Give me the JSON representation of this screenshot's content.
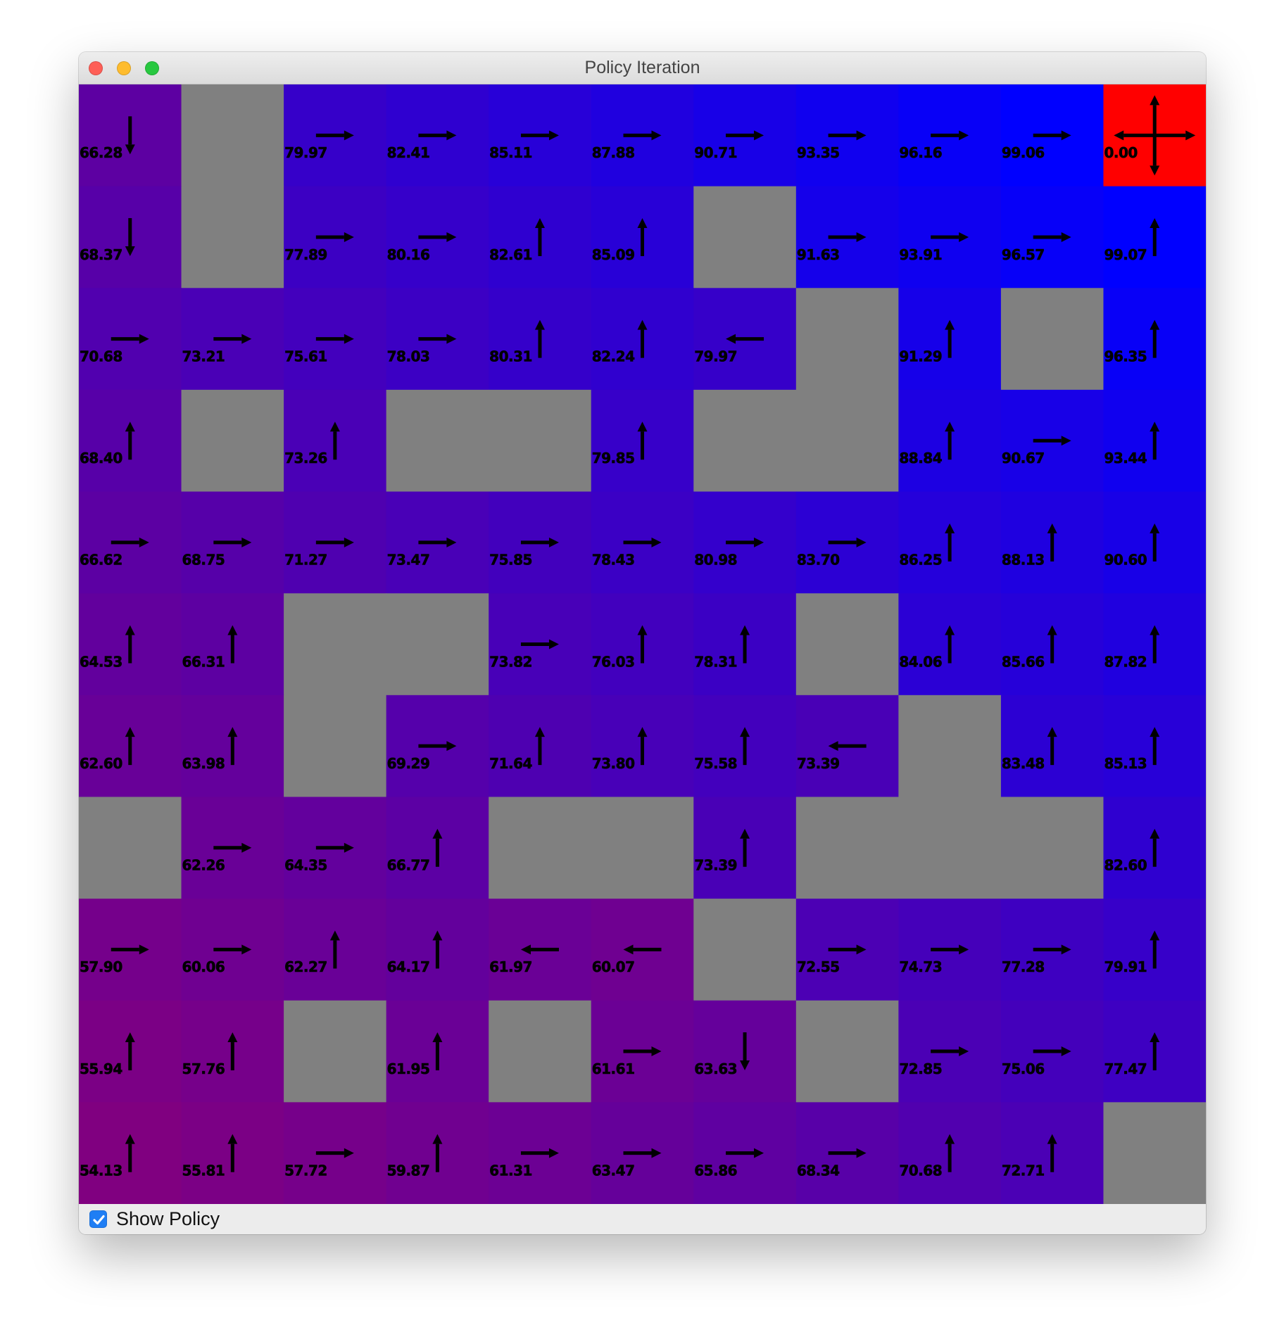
{
  "window": {
    "title": "Policy Iteration",
    "traffic_lights": [
      {
        "name": "close",
        "color": "#fe5f57"
      },
      {
        "name": "minimize",
        "color": "#febc2e"
      },
      {
        "name": "zoom",
        "color": "#28c840"
      }
    ]
  },
  "controls": {
    "show_policy_label": "Show Policy",
    "show_policy_checked": true
  },
  "colors": {
    "wall": "#808080",
    "goal": "#ff0000",
    "arrow": "#000000",
    "high_value": "#0000ff",
    "low_value": "#800080"
  },
  "grid": {
    "rows": 11,
    "cols": 11,
    "cells": [
      [
        {
          "v": "66.28",
          "a": "down"
        },
        {
          "wall": true
        },
        {
          "v": "79.97",
          "a": "right"
        },
        {
          "v": "82.41",
          "a": "right"
        },
        {
          "v": "85.11",
          "a": "right"
        },
        {
          "v": "87.88",
          "a": "right"
        },
        {
          "v": "90.71",
          "a": "right"
        },
        {
          "v": "93.35",
          "a": "right"
        },
        {
          "v": "96.16",
          "a": "right"
        },
        {
          "v": "99.06",
          "a": "right"
        },
        {
          "v": "0.00",
          "a": "all",
          "goal": true
        }
      ],
      [
        {
          "v": "68.37",
          "a": "down"
        },
        {
          "wall": true
        },
        {
          "v": "77.89",
          "a": "right"
        },
        {
          "v": "80.16",
          "a": "right"
        },
        {
          "v": "82.61",
          "a": "up"
        },
        {
          "v": "85.09",
          "a": "up"
        },
        {
          "wall": true
        },
        {
          "v": "91.63",
          "a": "right"
        },
        {
          "v": "93.91",
          "a": "right"
        },
        {
          "v": "96.57",
          "a": "right"
        },
        {
          "v": "99.07",
          "a": "up"
        }
      ],
      [
        {
          "v": "70.68",
          "a": "right"
        },
        {
          "v": "73.21",
          "a": "right"
        },
        {
          "v": "75.61",
          "a": "right"
        },
        {
          "v": "78.03",
          "a": "right"
        },
        {
          "v": "80.31",
          "a": "up"
        },
        {
          "v": "82.24",
          "a": "up"
        },
        {
          "v": "79.97",
          "a": "left"
        },
        {
          "wall": true
        },
        {
          "v": "91.29",
          "a": "up"
        },
        {
          "wall": true
        },
        {
          "v": "96.35",
          "a": "up"
        }
      ],
      [
        {
          "v": "68.40",
          "a": "up"
        },
        {
          "wall": true
        },
        {
          "v": "73.26",
          "a": "up"
        },
        {
          "wall": true
        },
        {
          "wall": true
        },
        {
          "v": "79.85",
          "a": "up"
        },
        {
          "wall": true
        },
        {
          "wall": true
        },
        {
          "v": "88.84",
          "a": "up"
        },
        {
          "v": "90.67",
          "a": "right"
        },
        {
          "v": "93.44",
          "a": "up"
        }
      ],
      [
        {
          "v": "66.62",
          "a": "right"
        },
        {
          "v": "68.75",
          "a": "right"
        },
        {
          "v": "71.27",
          "a": "right"
        },
        {
          "v": "73.47",
          "a": "right"
        },
        {
          "v": "75.85",
          "a": "right"
        },
        {
          "v": "78.43",
          "a": "right"
        },
        {
          "v": "80.98",
          "a": "right"
        },
        {
          "v": "83.70",
          "a": "right"
        },
        {
          "v": "86.25",
          "a": "up"
        },
        {
          "v": "88.13",
          "a": "up"
        },
        {
          "v": "90.60",
          "a": "up"
        }
      ],
      [
        {
          "v": "64.53",
          "a": "up"
        },
        {
          "v": "66.31",
          "a": "up"
        },
        {
          "wall": true
        },
        {
          "wall": true
        },
        {
          "v": "73.82",
          "a": "right"
        },
        {
          "v": "76.03",
          "a": "up"
        },
        {
          "v": "78.31",
          "a": "up"
        },
        {
          "wall": true
        },
        {
          "v": "84.06",
          "a": "up"
        },
        {
          "v": "85.66",
          "a": "up"
        },
        {
          "v": "87.82",
          "a": "up"
        }
      ],
      [
        {
          "v": "62.60",
          "a": "up"
        },
        {
          "v": "63.98",
          "a": "up"
        },
        {
          "wall": true
        },
        {
          "v": "69.29",
          "a": "right"
        },
        {
          "v": "71.64",
          "a": "up"
        },
        {
          "v": "73.80",
          "a": "up"
        },
        {
          "v": "75.58",
          "a": "up"
        },
        {
          "v": "73.39",
          "a": "left"
        },
        {
          "wall": true
        },
        {
          "v": "83.48",
          "a": "up"
        },
        {
          "v": "85.13",
          "a": "up"
        }
      ],
      [
        {
          "wall": true
        },
        {
          "v": "62.26",
          "a": "right"
        },
        {
          "v": "64.35",
          "a": "right"
        },
        {
          "v": "66.77",
          "a": "up"
        },
        {
          "wall": true
        },
        {
          "wall": true
        },
        {
          "v": "73.39",
          "a": "up"
        },
        {
          "wall": true
        },
        {
          "wall": true
        },
        {
          "wall": true
        },
        {
          "v": "82.60",
          "a": "up"
        }
      ],
      [
        {
          "v": "57.90",
          "a": "right"
        },
        {
          "v": "60.06",
          "a": "right"
        },
        {
          "v": "62.27",
          "a": "up"
        },
        {
          "v": "64.17",
          "a": "up"
        },
        {
          "v": "61.97",
          "a": "left"
        },
        {
          "v": "60.07",
          "a": "left"
        },
        {
          "wall": true
        },
        {
          "v": "72.55",
          "a": "right"
        },
        {
          "v": "74.73",
          "a": "right"
        },
        {
          "v": "77.28",
          "a": "right"
        },
        {
          "v": "79.91",
          "a": "up"
        }
      ],
      [
        {
          "v": "55.94",
          "a": "up"
        },
        {
          "v": "57.76",
          "a": "up"
        },
        {
          "wall": true
        },
        {
          "v": "61.95",
          "a": "up"
        },
        {
          "wall": true
        },
        {
          "v": "61.61",
          "a": "right"
        },
        {
          "v": "63.63",
          "a": "down"
        },
        {
          "wall": true
        },
        {
          "v": "72.85",
          "a": "right"
        },
        {
          "v": "75.06",
          "a": "right"
        },
        {
          "v": "77.47",
          "a": "up"
        }
      ],
      [
        {
          "v": "54.13",
          "a": "up"
        },
        {
          "v": "55.81",
          "a": "up"
        },
        {
          "v": "57.72",
          "a": "right"
        },
        {
          "v": "59.87",
          "a": "up"
        },
        {
          "v": "61.31",
          "a": "right"
        },
        {
          "v": "63.47",
          "a": "right"
        },
        {
          "v": "65.86",
          "a": "right"
        },
        {
          "v": "68.34",
          "a": "right"
        },
        {
          "v": "70.68",
          "a": "up"
        },
        {
          "v": "72.71",
          "a": "up"
        },
        {
          "wall": true
        }
      ]
    ]
  }
}
